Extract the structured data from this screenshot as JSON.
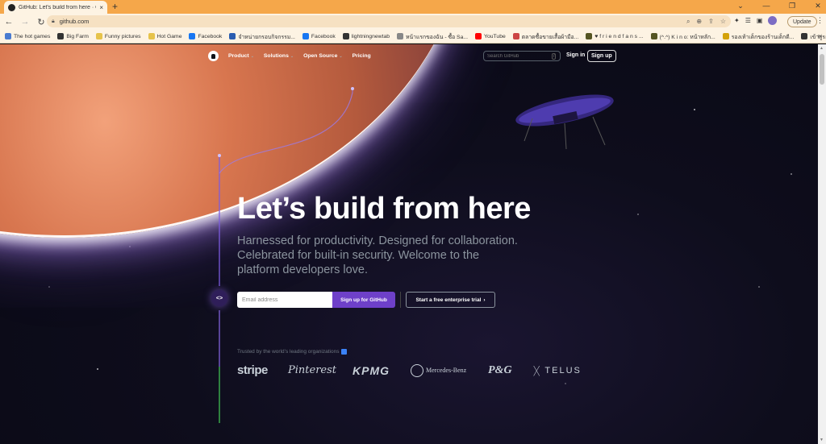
{
  "browser": {
    "tab_title": "GitHub: Let's build from here · GitHub",
    "tab_close": "×",
    "new_tab": "+",
    "window_controls": [
      "⌄",
      "—",
      "❐",
      "✕"
    ],
    "url": "github.com",
    "update_label": "Update",
    "bookmarks": [
      {
        "label": "The hot games",
        "color": "#4a7bd0"
      },
      {
        "label": "Big Farm",
        "color": "#333"
      },
      {
        "label": "Funny pictures",
        "color": "#e6c34a"
      },
      {
        "label": "Hot Game",
        "color": "#e6c34a"
      },
      {
        "label": "Facebook",
        "color": "#1877f2"
      },
      {
        "label": "จำหน่ายกรอบกิจกรรม...",
        "color": "#2a5db0"
      },
      {
        "label": "Facebook",
        "color": "#1877f2"
      },
      {
        "label": "lightningnewtab",
        "color": "#333"
      },
      {
        "label": "หน้าแรกของฉัน - ซื้อ Sa...",
        "color": "#888"
      },
      {
        "label": "YouTube",
        "color": "#ff0000"
      },
      {
        "label": "ตลาดซื้อขายเสื้อผ้ามือ...",
        "color": "#c44"
      },
      {
        "label": "♥ f r i e n d f a n s ...",
        "color": "#552"
      },
      {
        "label": "(^.^) K i n o: หน้าหลัก...",
        "color": "#552"
      },
      {
        "label": "รองเท้าเด็กของร้านเด็กดี...",
        "color": "#d4a20a"
      },
      {
        "label": "เข้าสู่ระบบ พิมพ์ LINK ไ...",
        "color": "#333"
      }
    ],
    "bookmarks_more": "»"
  },
  "nav": {
    "items": [
      {
        "label": "Product",
        "chevron": "⌄"
      },
      {
        "label": "Solutions",
        "chevron": "⌄"
      },
      {
        "label": "Open Source",
        "chevron": "⌄"
      },
      {
        "label": "Pricing",
        "chevron": ""
      }
    ],
    "search_placeholder": "Search GitHub",
    "search_shortcut": "/",
    "signin": "Sign in",
    "signup": "Sign up"
  },
  "hero": {
    "title": "Let’s build from here",
    "subtitle": "Harnessed for productivity. Designed for collaboration. Celebrated for built-in security. Welcome to the platform developers love.",
    "email_placeholder": "Email address",
    "signup_button": "Sign up for GitHub",
    "enterprise_button": "Start a free enterprise trial",
    "enterprise_arrow": "›",
    "code_icon": "<>",
    "trusted_text": "Trusted by the world’s leading organizations"
  },
  "logos": {
    "stripe": "stripe",
    "pinterest": "Pinterest",
    "kpmg": "KPMG",
    "mercedes": "Mercedes-Benz",
    "pg": "P&G",
    "telus": "TELUS"
  }
}
